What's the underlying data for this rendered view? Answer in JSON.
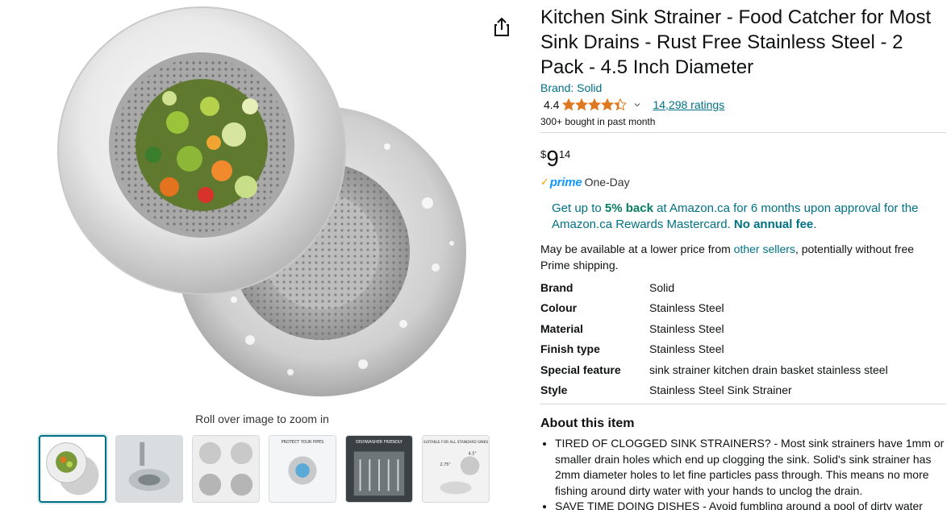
{
  "product": {
    "title": "Kitchen Sink Strainer - Food Catcher for Most Sink Drains - Rust Free Stainless Steel - 2 Pack - 4.5 Inch Diameter",
    "brand_link": "Brand: Solid",
    "rating_value": "4.4",
    "rating_fraction": 0.88,
    "ratings_count": "14,298 ratings",
    "bought": "300+ bought in past month"
  },
  "price": {
    "currency": "$",
    "whole": "9",
    "fraction": "14"
  },
  "delivery": {
    "prime_check": "✓",
    "prime_label": "prime",
    "prime_suffix": "One-Day"
  },
  "promo": {
    "p1": "Get up to ",
    "p2": "5% back",
    "p3": " at Amazon.ca for 6 months upon approval for the Amazon.ca Rewards Mastercard. ",
    "p4": "No annual fee",
    "p5": "."
  },
  "availability": {
    "a1": "May be available at a lower price from ",
    "link": "other sellers",
    "a2": ", potentially without free Prime shipping."
  },
  "specs": [
    {
      "key": "Brand",
      "value": "Solid"
    },
    {
      "key": "Colour",
      "value": "Stainless Steel"
    },
    {
      "key": "Material",
      "value": "Stainless Steel"
    },
    {
      "key": "Finish type",
      "value": "Stainless Steel"
    },
    {
      "key": "Special feature",
      "value": "sink strainer kitchen drain basket stainless steel"
    },
    {
      "key": "Style",
      "value": "Stainless Steel Sink Strainer"
    }
  ],
  "about": {
    "heading": "About this item",
    "bullets": [
      "TIRED OF CLOGGED SINK STRAINERS? - Most sink strainers have 1mm or smaller drain holes which end up clogging the sink. Solid's sink strainer has 2mm diameter holes to let fine particles pass through. This means no more fishing around dirty water with your hands to unclog the drain.",
      "SAVE TIME DOING DISHES - Avoid fumbling around a pool of dirty water"
    ]
  },
  "gallery": {
    "zoom_hint": "Roll over image to zoom in",
    "thumb_texts": [
      "PROTECT YOUR PIPES",
      "DISHWASHER FRIENDLY",
      "SUITABLE FOR ALL STANDARD SINKS",
      "2.75\"",
      "4.5\""
    ]
  },
  "colors": {
    "link": "#007185",
    "prime_blue": "#1399ff",
    "star": "#de7921",
    "green": "#067d62",
    "active_thumb": "#007185"
  },
  "icons": [
    "share-icon",
    "star-icon",
    "chevron-down-icon",
    "prime-check-icon"
  ]
}
